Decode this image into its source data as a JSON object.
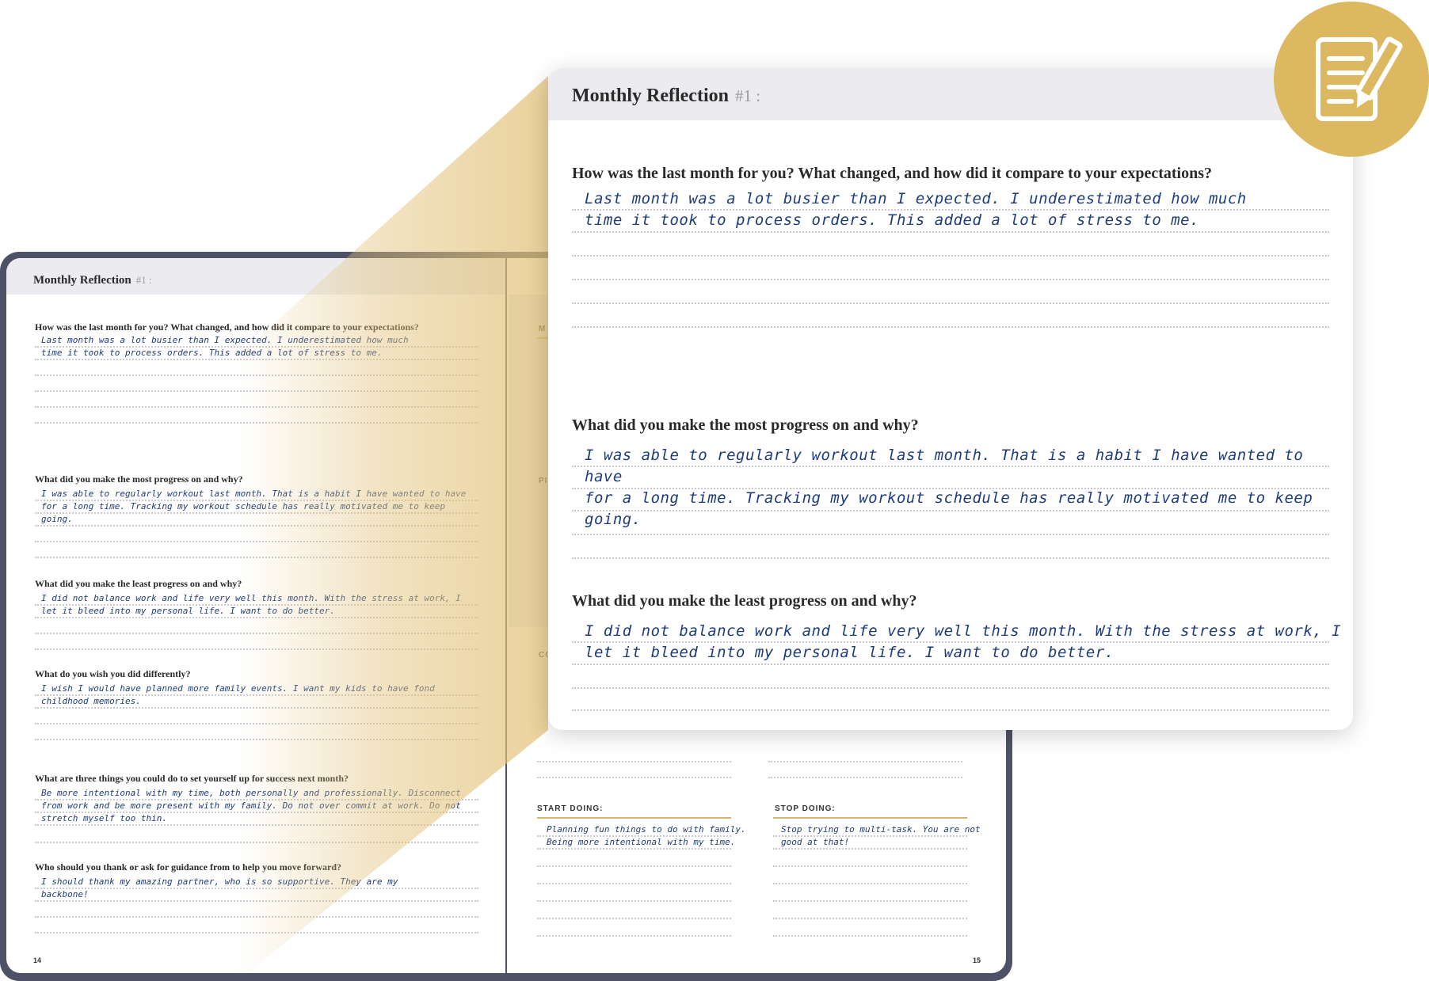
{
  "notebook": {
    "left_page": {
      "header": {
        "title": "Monthly Reflection",
        "number": "#1 :"
      },
      "questions": [
        {
          "q": "How was the last month for you? What changed, and how did it compare to your expectations?",
          "a": [
            "Last month was a lot busier than I expected. I underestimated how much",
            "time it took to process orders. This added a lot of stress to me."
          ]
        },
        {
          "q": "What did you make the most progress on and why?",
          "a": [
            "I was able to regularly workout last month. That is a habit I have wanted to have",
            "for a long time. Tracking my workout schedule has really motivated me to keep",
            "going."
          ]
        },
        {
          "q": "What did you make the least progress on and why?",
          "a": [
            "I did not balance work and life very well this month. With the stress at work, I",
            "let it bleed into my personal life. I want to do better."
          ]
        },
        {
          "q": "What do you wish you did differently?",
          "a": [
            "I wish I would have planned more family events. I want my kids to have fond",
            "childhood memories."
          ]
        },
        {
          "q": "What are three things you could do to set yourself up for success next month?",
          "a": [
            "Be more intentional with my time, both personally and professionally. Disconnect",
            "from work and be more present with my family. Do not over commit at work. Do not",
            "stretch myself too thin."
          ]
        },
        {
          "q": "Who should you thank or ask for guidance from to help you move forward?",
          "a": [
            "I should thank my amazing partner, who is so supportive. They are my",
            "backbone!"
          ]
        }
      ],
      "page_number": "14"
    },
    "right_page": {
      "partial_labels": [
        "M",
        "PI",
        "CO"
      ],
      "start_doing": {
        "label": "START DOING:",
        "lines": [
          "Planning fun things to do with family.",
          "Being more intentional with my time."
        ]
      },
      "stop_doing": {
        "label": "STOP DOING:",
        "lines": [
          "Stop trying to multi-task. You are not",
          "good at that!"
        ]
      },
      "page_number": "15"
    }
  },
  "zoom": {
    "header": {
      "title": "Monthly Reflection",
      "number": "#1 :"
    },
    "questions": [
      {
        "q": "How was the last month for you? What changed, and how did it compare to your expectations?",
        "a": [
          "Last month was a lot busier than I expected. I underestimated how much",
          "time it took to process orders. This added a lot of stress to me."
        ]
      },
      {
        "q": "What did you make the most progress on and why?",
        "a": [
          "I was able to regularly workout last month. That is a habit I have wanted to have",
          "for a long time. Tracking my workout schedule has really motivated me to keep",
          "going."
        ]
      },
      {
        "q": "What did you make the least progress on and why?",
        "a": [
          "I did not balance work and life very well this month. With the stress at work, I",
          "let it bleed into my personal life. I want to do better."
        ]
      }
    ]
  },
  "badge": {
    "icon": "document-pencil-icon",
    "color": "#dcb960"
  },
  "colors": {
    "frame": "#4e5266",
    "header_bg": "#ececf0",
    "ink": "#1d3c7a",
    "accent_gold": "#d6b56e"
  }
}
